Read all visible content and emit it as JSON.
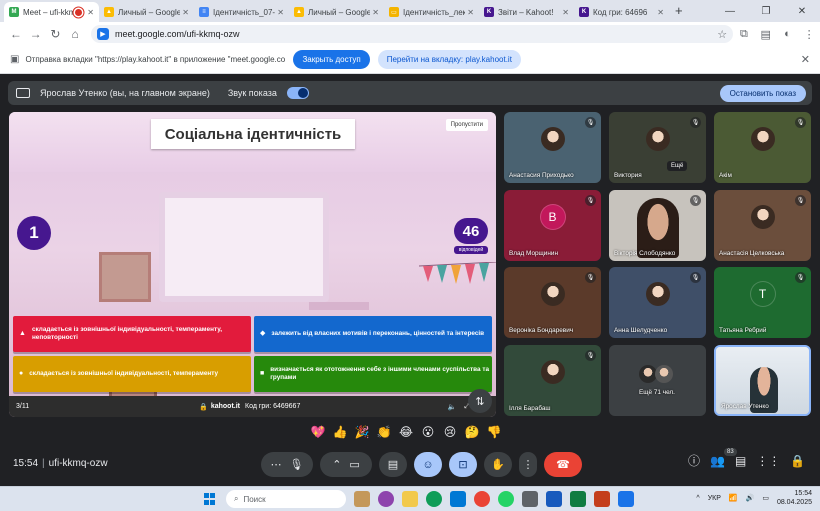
{
  "browser": {
    "tabs": [
      {
        "title": "Meet – ufi-kkmq",
        "fav_color": "#34a853",
        "fav_letter": "M",
        "active": true
      },
      {
        "title": "Личный – Google Д",
        "fav_color": "#fbbc04",
        "fav_letter": "▲"
      },
      {
        "title": "Ідентичність_07-04",
        "fav_color": "#4285f4",
        "fav_letter": "≡"
      },
      {
        "title": "Личный – Google Д",
        "fav_color": "#fbbc04",
        "fav_letter": "▲"
      },
      {
        "title": "Ідентичність_лекці",
        "fav_color": "#f4b400",
        "fav_letter": "▭"
      },
      {
        "title": "Звіти – Kahoot!",
        "fav_color": "#46178f",
        "fav_letter": "K"
      },
      {
        "title": "Код гри: 64696",
        "fav_color": "#46178f",
        "fav_letter": "K"
      }
    ],
    "new_tab": "+",
    "url": "meet.google.com/ufi-kkmq-ozw"
  },
  "infobar": {
    "message": "Отправка вкладки \"https://play.kahoot.it\" в приложение \"meet.google.com\"...",
    "share_label": "Закрыть доступ",
    "goto_label": "Перейти на вкладку: play.kahoot.it"
  },
  "presenter": {
    "name": "Ярослав Утенко (вы, на главном экране)",
    "sound_label": "Звук показа",
    "stop_label": "Остановить показ"
  },
  "slide": {
    "title": "Соціальна ідентичність",
    "skip": "Пропустити",
    "timer": "1",
    "answers_count": "46",
    "answers_label": "відповідей",
    "options": [
      {
        "symbol": "▲",
        "text": "складається із зовнішньої індивідуальності, темпераменту, неповторності"
      },
      {
        "symbol": "◆",
        "text": "залежить від власних мотивів і переконань, цінностей та інтересів"
      },
      {
        "symbol": "●",
        "text": "складається із зовнішньої індивідуальності, темпераменту"
      },
      {
        "symbol": "■",
        "text": "визначається як ототожнення себе з іншими членами суспільства та групами"
      }
    ],
    "progress": "3/11",
    "site": "kahoot.it",
    "game_code": "Код гри: 6469667"
  },
  "participants": [
    {
      "name": "Анастасия Приходько",
      "bg": "#4a6271",
      "type": "photo"
    },
    {
      "name": "Виктория",
      "bg": "#3a3f34",
      "type": "photo",
      "more": "Ещё"
    },
    {
      "name": "Акім",
      "bg": "#4b5a34",
      "type": "photo"
    },
    {
      "name": "Влад Морщинин",
      "bg": "#8a1c37",
      "type": "letter",
      "letter": "В",
      "letter_bg": "#c2185b"
    },
    {
      "name": "Вікторія Слободянко",
      "bg": "#c7c3bd",
      "type": "video"
    },
    {
      "name": "Анастасія Целковська",
      "bg": "#6b4e3c",
      "type": "photo"
    },
    {
      "name": "Вероніка Бондаревич",
      "bg": "#5b3a2a",
      "type": "photo"
    },
    {
      "name": "Анна Шелудченко",
      "bg": "#3f4f68",
      "type": "photo"
    },
    {
      "name": "Татьяна Ребрий",
      "bg": "#1e6b30",
      "type": "letter",
      "letter": "Т",
      "letter_bg": "#1e6b30"
    },
    {
      "name": "Ілля Барабаш",
      "bg": "#324a3a",
      "type": "photo"
    },
    {
      "name": "Ещё 71 чел.",
      "bg": "#3c4043",
      "type": "more"
    },
    {
      "name": "Ярослав Утенко",
      "bg": "#dfe5ec",
      "type": "self"
    }
  ],
  "reactions": [
    "💖",
    "👍",
    "🎉",
    "👏",
    "😂",
    "😮",
    "😢",
    "🤔",
    "👎"
  ],
  "meeting": {
    "time": "15:54",
    "separator": "|",
    "code": "ufi-kkmq-ozw",
    "people_count": "83"
  },
  "taskbar": {
    "search_placeholder": "Поиск",
    "lang": "УКР",
    "time": "15:54",
    "date": "08.04.2025"
  }
}
